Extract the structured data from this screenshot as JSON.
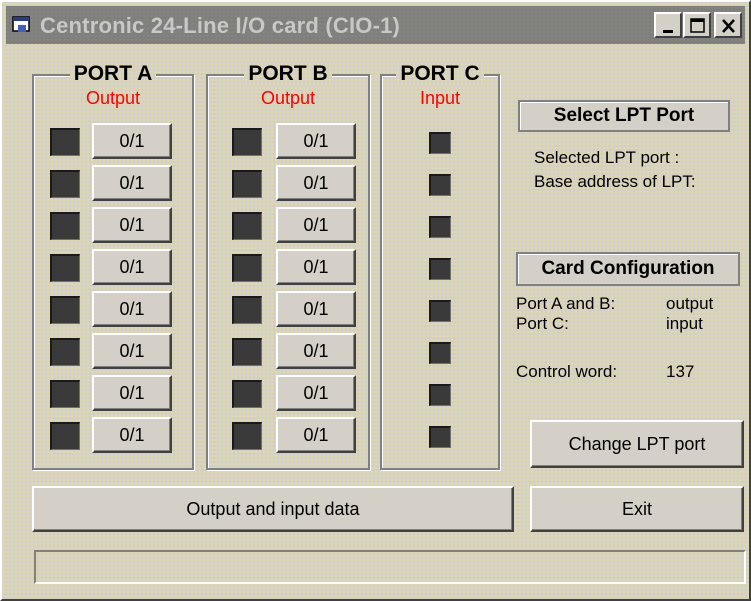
{
  "window": {
    "title": "Centronic 24-Line I/O card (CIO-1)"
  },
  "ports": [
    {
      "title": "PORT A",
      "mode": "Output",
      "buttons": [
        "0/1",
        "0/1",
        "0/1",
        "0/1",
        "0/1",
        "0/1",
        "0/1",
        "0/1"
      ]
    },
    {
      "title": "PORT B",
      "mode": "Output",
      "buttons": [
        "0/1",
        "0/1",
        "0/1",
        "0/1",
        "0/1",
        "0/1",
        "0/1",
        "0/1"
      ]
    },
    {
      "title": "PORT C",
      "mode": "Input"
    }
  ],
  "lpt": {
    "header": "Select LPT Port",
    "selected_label": "Selected LPT  port :",
    "base_label": "Base address of LPT:"
  },
  "config": {
    "header": "Card Configuration",
    "port_ab_label": "Port A and B:",
    "port_ab_value": "output",
    "port_c_label": "Port C:",
    "port_c_value": "input",
    "control_word_label": "Control word:",
    "control_word_value": "137"
  },
  "buttons": {
    "change_lpt": "Change LPT port",
    "output_input": "Output and input data",
    "exit": "Exit"
  },
  "status": {
    "text": ""
  },
  "colors": {
    "port_mode": "#ff0000",
    "led_off": "#3a3a3a",
    "face": "#d4d0c8"
  }
}
